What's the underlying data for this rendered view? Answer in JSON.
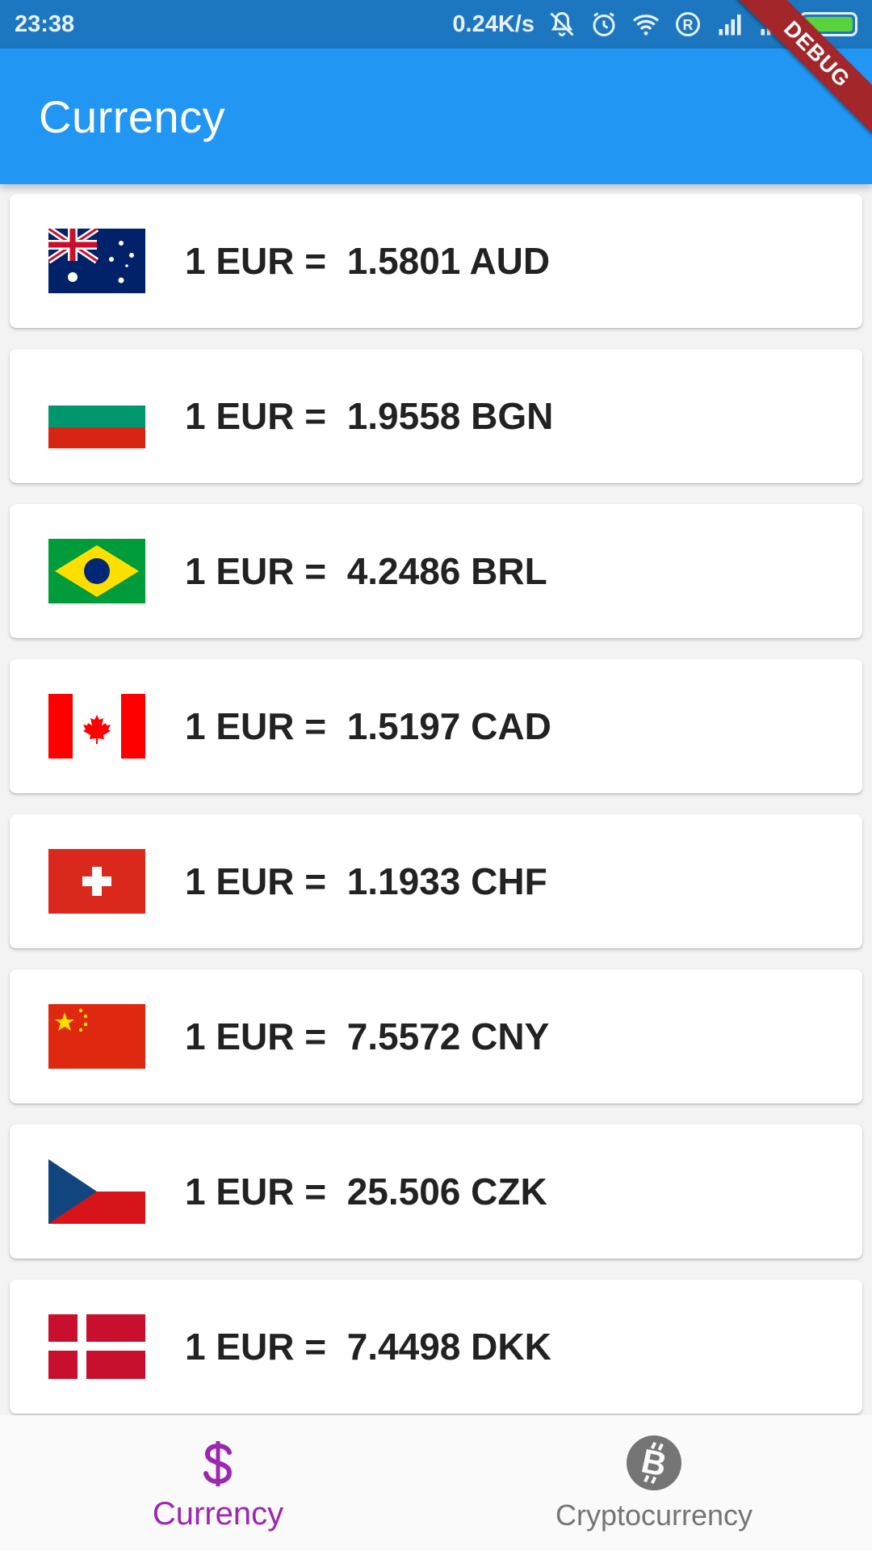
{
  "status_bar": {
    "time": "23:38",
    "network_speed": "0.24K/s",
    "icons": [
      "mute-icon",
      "alarm-icon",
      "wifi-icon",
      "registered-icon",
      "signal-icon",
      "signal-icon",
      "battery-icon"
    ],
    "battery_level": 1.0,
    "battery_color": "#5bd13b"
  },
  "debug_banner": "DEBUG",
  "app_bar": {
    "title": "Currency",
    "color": "#2196f3"
  },
  "rates": [
    {
      "text": "1 EUR =  1.5801 AUD",
      "flag": "australia-flag-icon"
    },
    {
      "text": "1 EUR =  1.9558 BGN",
      "flag": "bulgaria-flag-icon"
    },
    {
      "text": "1 EUR =  4.2486 BRL",
      "flag": "brazil-flag-icon"
    },
    {
      "text": "1 EUR =  1.5197 CAD",
      "flag": "canada-flag-icon"
    },
    {
      "text": "1 EUR =  1.1933 CHF",
      "flag": "switzerland-flag-icon"
    },
    {
      "text": "1 EUR =  7.5572 CNY",
      "flag": "china-flag-icon"
    },
    {
      "text": "1 EUR =  25.506 CZK",
      "flag": "czech-flag-icon"
    },
    {
      "text": "1 EUR =  7.4498 DKK",
      "flag": "denmark-flag-icon"
    }
  ],
  "bottom_nav": {
    "items": [
      {
        "label": "Currency",
        "icon": "dollar-icon",
        "active": true,
        "color": "#9c27b0"
      },
      {
        "label": "Cryptocurrency",
        "icon": "bitcoin-icon",
        "active": false,
        "color": "#757575"
      }
    ]
  }
}
